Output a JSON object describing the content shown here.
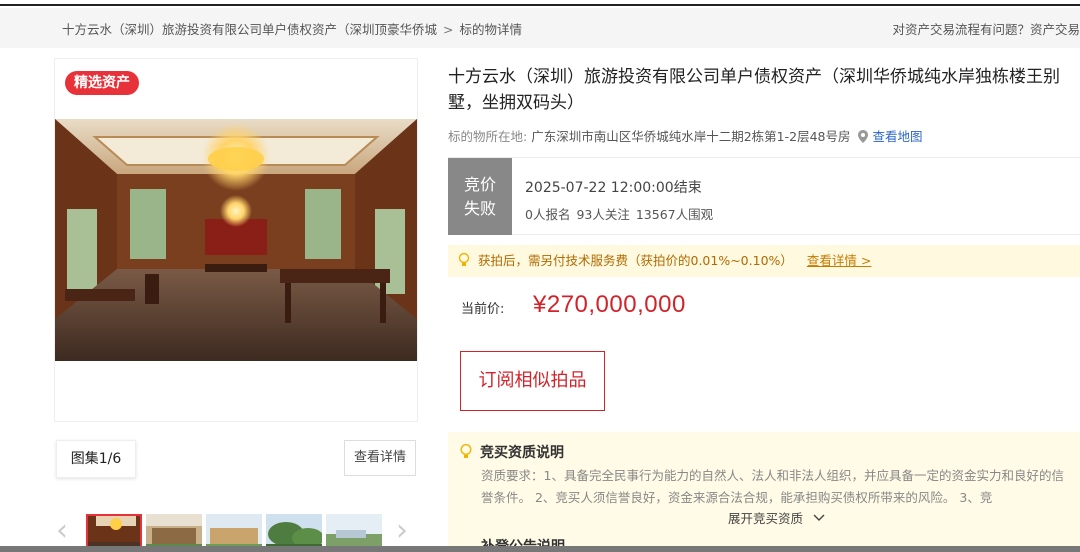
{
  "breadcrumb": {
    "items": [
      "十方云水（深圳）旅游投资有限公司单户债权资产（深圳顶豪华侨城",
      "标的物详情"
    ],
    "separator": ">"
  },
  "help_text": "对资产交易流程有问题？资产交易",
  "gallery": {
    "badge": "精选资产",
    "album_counter": "图集1/6",
    "detail_button": "查看详情",
    "thumbnails": 6,
    "active_thumbnail": 1
  },
  "asset": {
    "title": "十方云水（深圳）旅游投资有限公司单户债权资产（深圳华侨城纯水岸独栋楼王别墅，坐拥双码头）",
    "location_label": "标的物所在地:",
    "location_value": "广东深圳市南山区华侨城纯水岸十二期2栋第1-2层48号房",
    "map_link": "查看地图"
  },
  "status": {
    "label": "竞价失败",
    "end_time": "2025-07-22 12:00:00结束",
    "signups": "0人报名",
    "followers": "93人关注",
    "viewers": "13567人围观"
  },
  "notice": {
    "text": "获拍后，需另付技术服务费（获拍价的0.01%~0.10%）",
    "link": "查看详情 >"
  },
  "price": {
    "label": "当前价:",
    "value": "¥270,000,000"
  },
  "subscribe_button": "订阅相似拍品",
  "qualification": {
    "heading": "竞买资质说明",
    "text": "资质要求：1、具备完全民事行为能力的自然人、法人和非法人组织，并应具备一定的资金实力和良好的信誉条件。 2、竞买人须信誉良好，资金来源合法合规，能承担购买债权所带来的风险。 3、竞",
    "expand": "展开竞买资质",
    "next_heading": "补登公告说明"
  },
  "colors": {
    "accent_red": "#d3232a",
    "badge_red": "#e8323a",
    "status_gray": "#888888",
    "notice_bg": "#fff9e0",
    "link_blue": "#2b66c9"
  },
  "icons": [
    "location-pin-icon",
    "lightbulb-icon",
    "chevron-down-icon",
    "chevron-left-icon",
    "chevron-right-icon"
  ]
}
